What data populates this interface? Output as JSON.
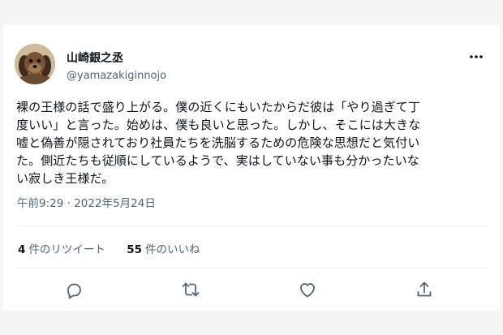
{
  "user": {
    "name": "山崎銀之丞",
    "handle": "@yamazakiginnojo"
  },
  "tweet": {
    "lines": [
      "裸の王様の話で盛り上がる。僕の近くにもいたからだ彼は「やり過ぎて丁",
      "度いい」と言った。始めは、僕も良いと思った。しかし、そこには大きな",
      "嘘と偽善が隠されており社員たちを洗脳するための危険な思想だと気付い",
      "た。側近たちも従順にしているようで、実はしていない事も分かったいな",
      "い寂しき王様だ。"
    ],
    "timestamp": "午前9:29 · 2022年5月24日"
  },
  "stats": {
    "retweets_count": "4",
    "retweets_label": "件のリツイート",
    "likes_count": "55",
    "likes_label": "件のいいね"
  },
  "icons": {
    "more": "more-icon",
    "reply": "reply-icon",
    "retweet": "retweet-icon",
    "like": "like-icon",
    "share": "share-icon"
  },
  "colors": {
    "text": "#0f1419",
    "secondary": "#536471",
    "divider": "#eff3f4",
    "background": "#f5f5f5",
    "card": "#ffffff"
  }
}
